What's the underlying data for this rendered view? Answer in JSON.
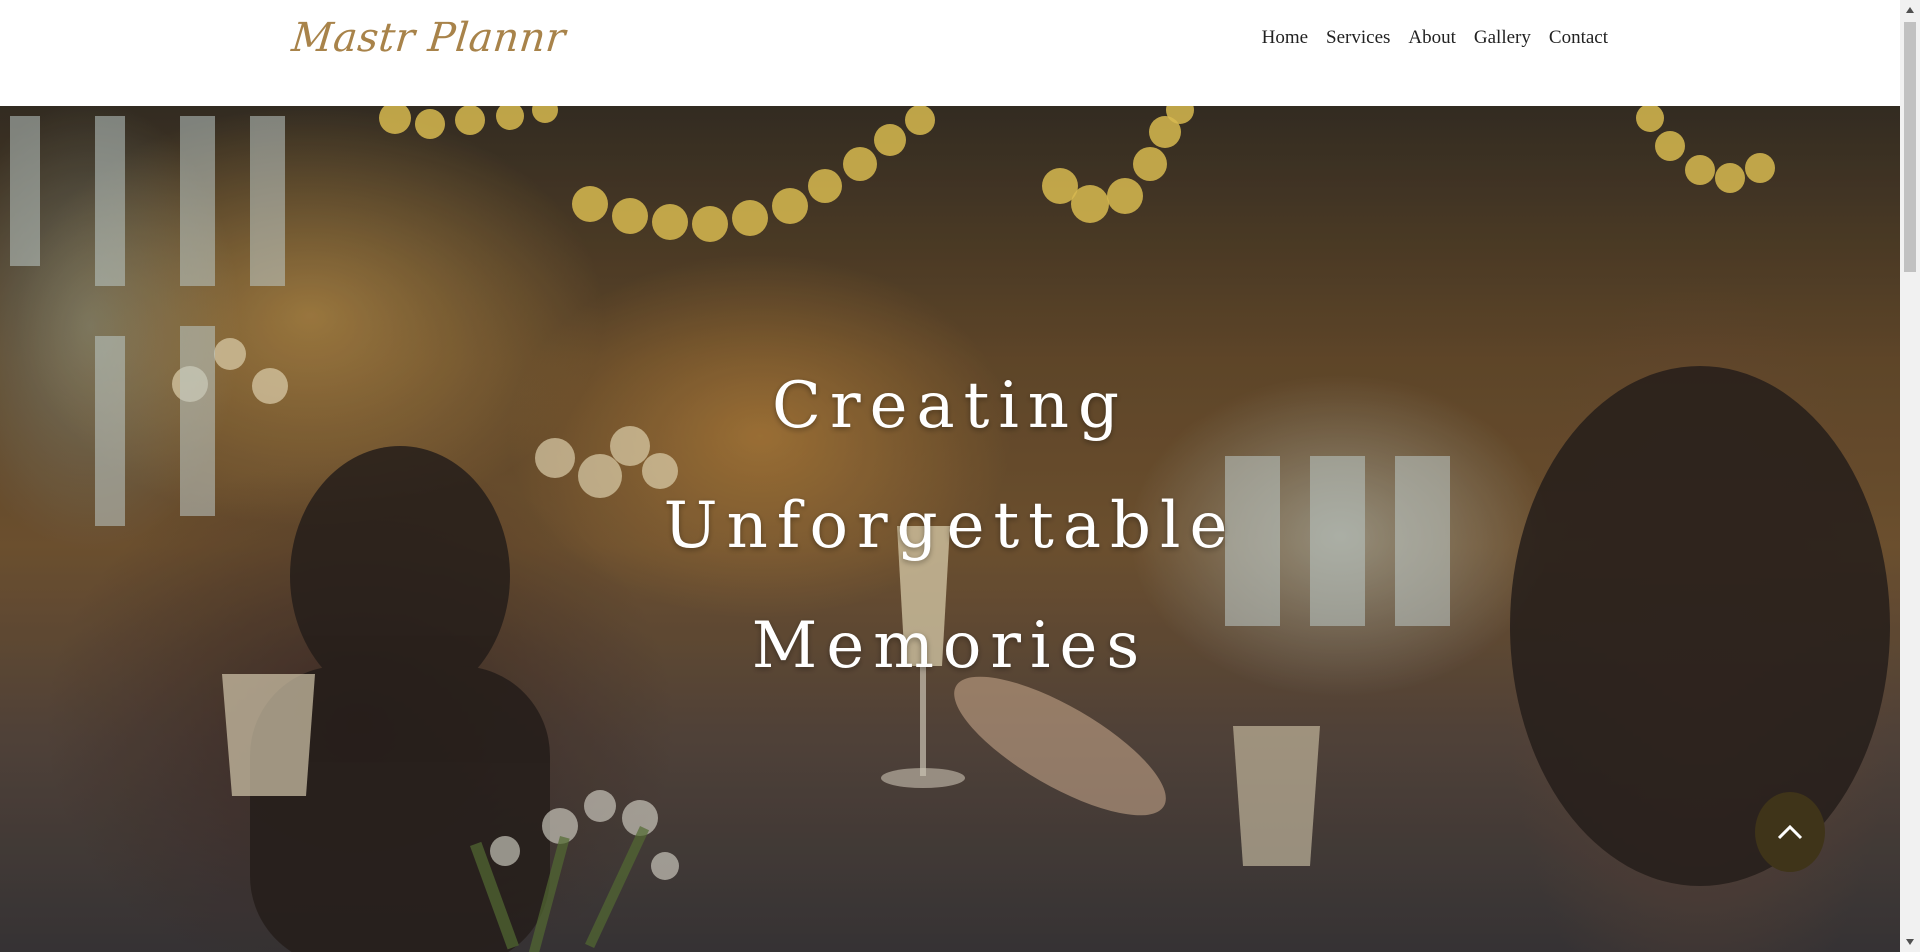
{
  "header": {
    "logo": "Mastr Plannr",
    "nav": [
      {
        "label": "Home"
      },
      {
        "label": "Services"
      },
      {
        "label": "About"
      },
      {
        "label": "Gallery"
      },
      {
        "label": "Contact"
      }
    ]
  },
  "hero": {
    "title_lines": [
      "Creating",
      "Unforgettable",
      "Memories"
    ],
    "background_icon": "celebration-photo",
    "colors": {
      "title": "#ffffff",
      "scroll_button": "#3f3419",
      "logo": "#a8834a"
    }
  },
  "scroll_top": {
    "icon": "chevron-up-icon"
  },
  "scrollbar": {
    "up_icon": "triangle-up-icon",
    "down_icon": "triangle-down-icon"
  }
}
